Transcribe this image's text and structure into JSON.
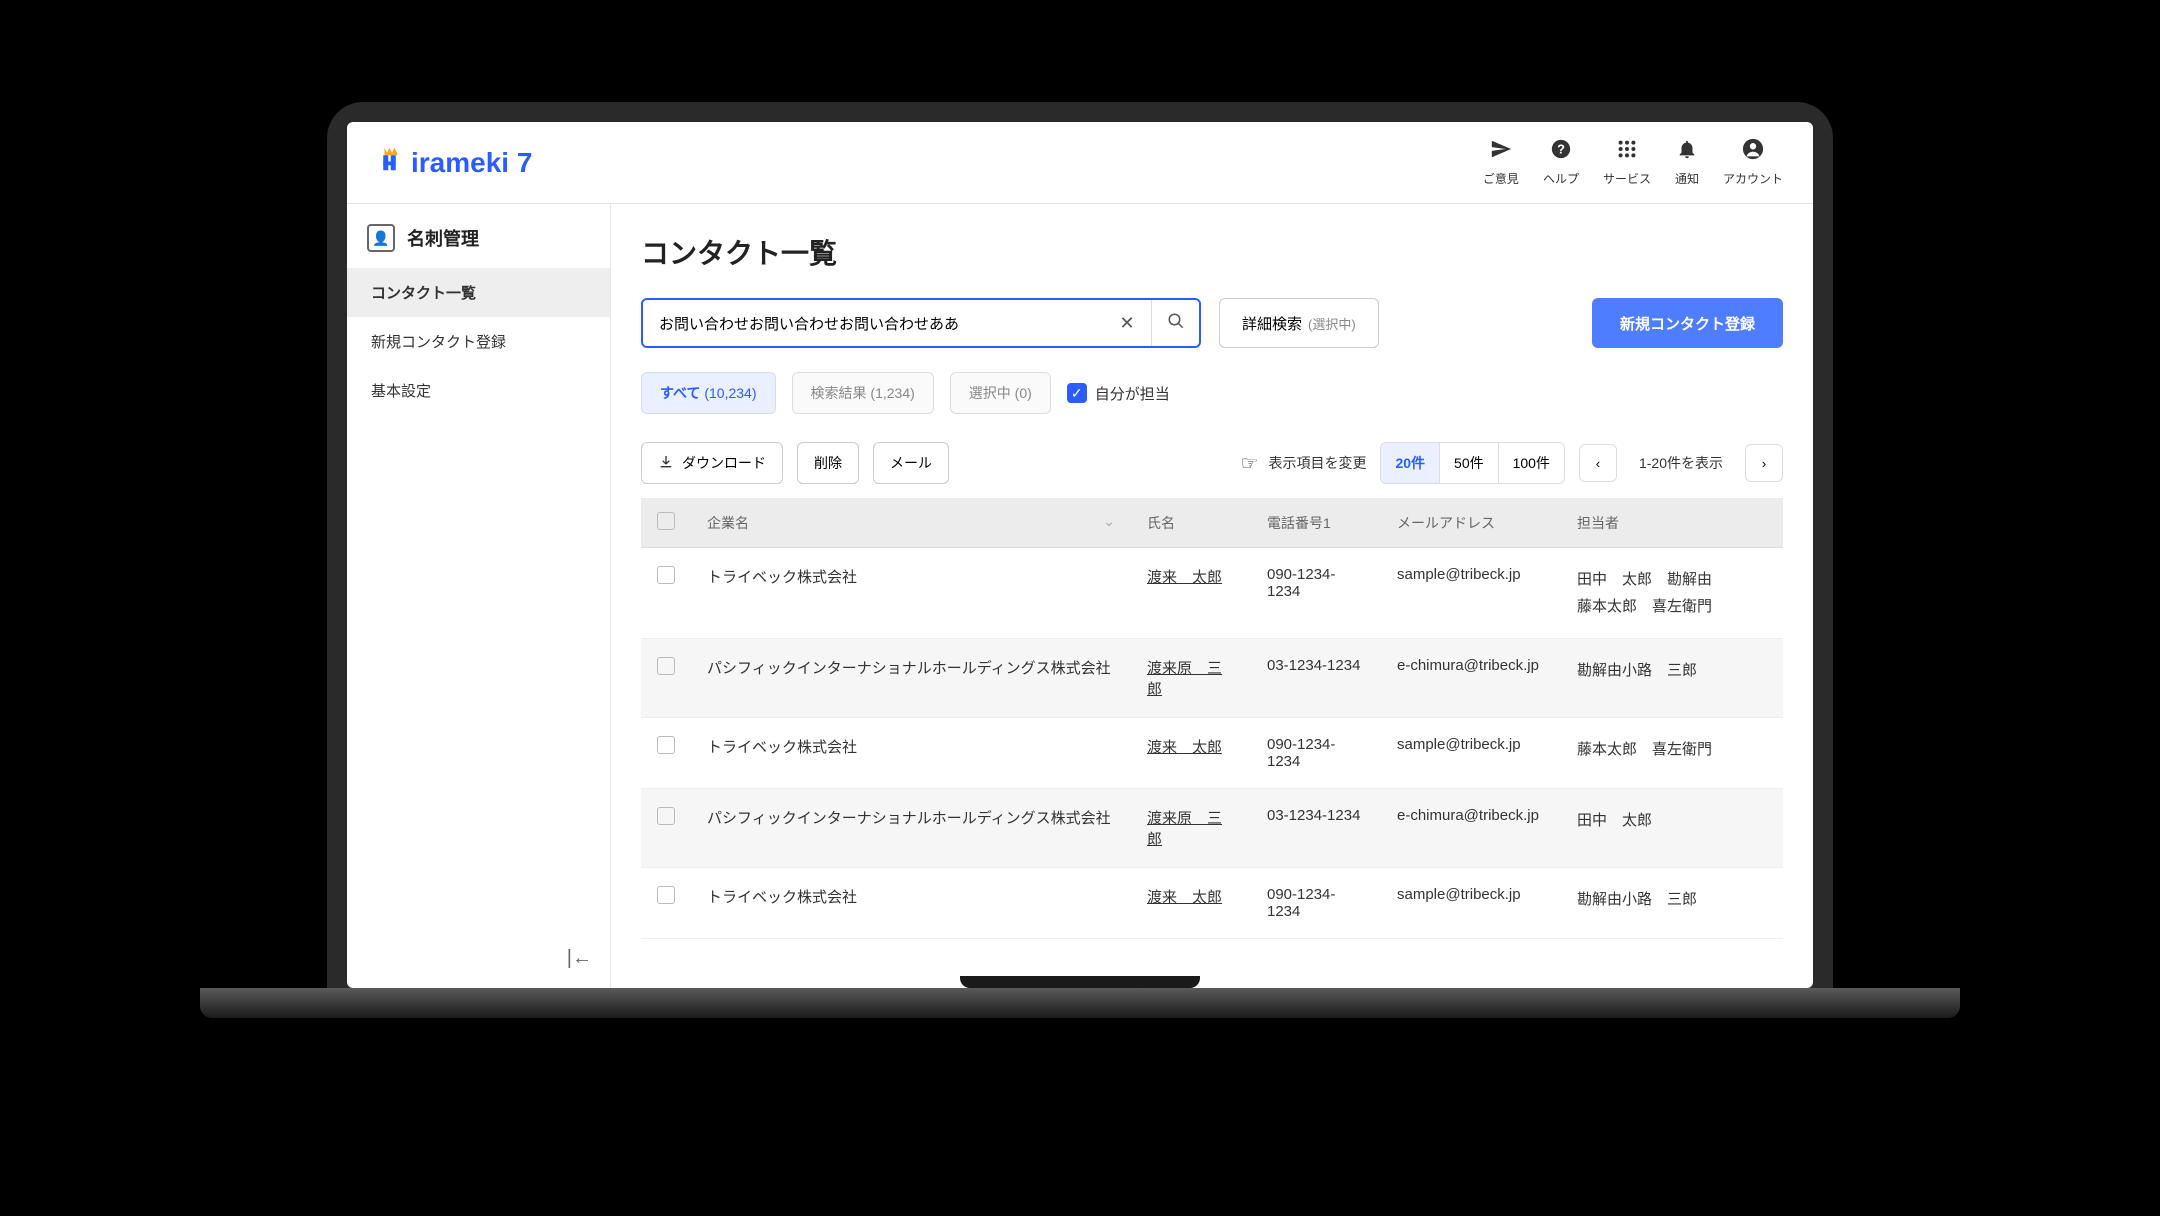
{
  "topbar": {
    "logo_text": "irameki 7",
    "actions": [
      {
        "label": "ご意見",
        "icon": "send-icon",
        "glyph": "✈"
      },
      {
        "label": "ヘルプ",
        "icon": "help-icon",
        "glyph": "?"
      },
      {
        "label": "サービス",
        "icon": "apps-icon",
        "glyph": "⋮⋮⋮"
      },
      {
        "label": "通知",
        "icon": "bell-icon",
        "glyph": "🔔"
      },
      {
        "label": "アカウント",
        "icon": "account-icon",
        "glyph": "👤"
      }
    ]
  },
  "sidebar": {
    "heading": "名刺管理",
    "items": [
      {
        "label": "コンタクト一覧",
        "active": true
      },
      {
        "label": "新規コンタクト登録",
        "active": false
      },
      {
        "label": "基本設定",
        "active": false
      }
    ]
  },
  "page": {
    "title": "コンタクト一覧",
    "search_value": "お問い合わせお問い合わせお問い合わせああ",
    "adv_search": "詳細検索",
    "adv_search_status": "(選択中)",
    "primary_button": "新規コンタクト登録",
    "filters": {
      "all": {
        "label": "すべて",
        "count": "(10,234)"
      },
      "results": {
        "label": "検索結果",
        "count": "(1,234)"
      },
      "selected": {
        "label": "選択中",
        "count": "(0)"
      },
      "mine_label": "自分が担当"
    },
    "toolbar": {
      "download": "ダウンロード",
      "delete": "削除",
      "mail": "メール",
      "columns": "表示項目を変更",
      "pagesize": [
        "20件",
        "50件",
        "100件"
      ],
      "range": "1-20件を表示"
    },
    "table": {
      "headers": {
        "company": "企業名",
        "name": "氏名",
        "tel": "電話番号1",
        "email": "メールアドレス",
        "staff": "担当者"
      },
      "rows": [
        {
          "company": "トライベック株式会社",
          "name": "渡来　太郎",
          "tel": "090-1234-1234",
          "email": "sample@tribeck.jp",
          "staff": [
            "田中　太郎　勘解由",
            "藤本太郎　喜左衛門"
          ]
        },
        {
          "company": "パシフィックインターナショナルホールディングス株式会社",
          "name": "渡来原　三郎",
          "tel": "03-1234-1234",
          "email": "e-chimura@tribeck.jp",
          "staff": [
            "勘解由小路　三郎"
          ]
        },
        {
          "company": "トライベック株式会社",
          "name": "渡来　太郎",
          "tel": "090-1234-1234",
          "email": "sample@tribeck.jp",
          "staff": [
            "藤本太郎　喜左衛門"
          ]
        },
        {
          "company": "パシフィックインターナショナルホールディングス株式会社",
          "name": "渡来原　三郎",
          "tel": "03-1234-1234",
          "email": "e-chimura@tribeck.jp",
          "staff": [
            "田中　太郎"
          ]
        },
        {
          "company": "トライベック株式会社",
          "name": "渡来　太郎",
          "tel": "090-1234-1234",
          "email": "sample@tribeck.jp",
          "staff": [
            "勘解由小路　三郎"
          ]
        }
      ]
    }
  }
}
